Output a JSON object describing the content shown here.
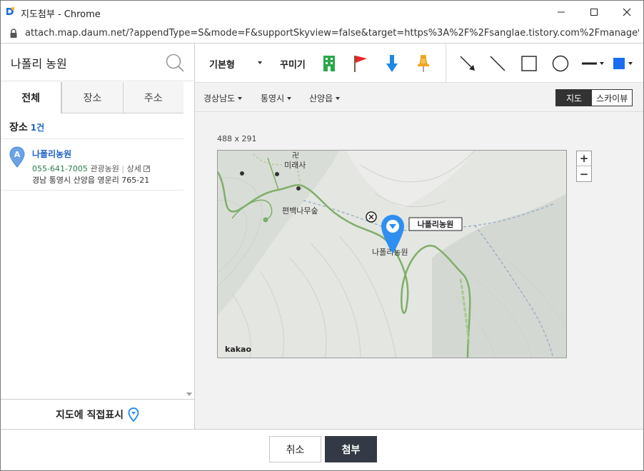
{
  "window": {
    "title": "지도첨부 - Chrome",
    "url": "attach.map.daum.net/?appendType=S&mode=F&supportSkyview=false&target=https%3A%2F%2Fsanglae.tistory.com%2Fmanage%..."
  },
  "search": {
    "value": "나폴리 농원"
  },
  "tabs": [
    {
      "label": "전체"
    },
    {
      "label": "장소"
    },
    {
      "label": "주소"
    }
  ],
  "results": {
    "heading": "장소",
    "count": "1건",
    "items": [
      {
        "marker": "A",
        "name": "나폴리농원",
        "phone": "055-641-7005",
        "category": "관광농원",
        "detail_link": "상세",
        "address": "경남 통영시 산양읍 영운리 765-21"
      }
    ]
  },
  "direct_mark": {
    "label": "지도에 직접표시"
  },
  "toolbar": {
    "style_select": "기본형",
    "decorate_label": "꾸미기",
    "fill_color": "#1a6df0"
  },
  "regions": [
    {
      "label": "경상남도"
    },
    {
      "label": "통영시"
    },
    {
      "label": "산양읍"
    }
  ],
  "map_type": {
    "map": "지도",
    "sky": "스카이뷰"
  },
  "map": {
    "size_label": "488 x 291",
    "labels": {
      "temple": "미래사",
      "forest": "편백나무숲",
      "farm": "나폴리농원"
    },
    "callout": "나폴리농원",
    "attribution": "kakao"
  },
  "zoom": {
    "in": "+",
    "out": "−"
  },
  "footer": {
    "cancel": "취소",
    "attach": "첨부"
  },
  "colors": {
    "accent_blue": "#1e62c8",
    "pin_blue": "#2f8ff0",
    "button_dark": "#333a45"
  }
}
